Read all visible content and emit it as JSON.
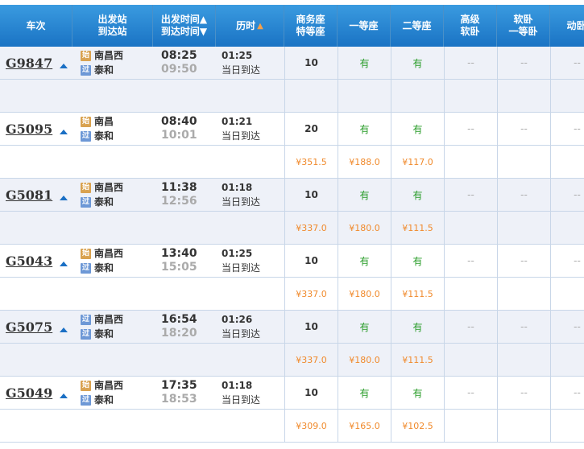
{
  "header": {
    "train": "车次",
    "station": [
      "出发站",
      "到达站"
    ],
    "time": [
      "出发时间▲",
      "到达时间▼"
    ],
    "duration": "历时",
    "seats": [
      [
        "商务座",
        "特等座"
      ],
      [
        "一等座"
      ],
      [
        "二等座"
      ],
      [
        "高级",
        "软卧"
      ],
      [
        "软卧",
        "一等卧"
      ],
      [
        "动卧"
      ]
    ]
  },
  "badges": {
    "start": "始",
    "pass": "过"
  },
  "trains": [
    {
      "no": "G9847",
      "from": "南昌西",
      "from_type": "start",
      "to": "泰和",
      "dep": "08:25",
      "arr": "09:50",
      "dur": "01:25",
      "day": "当日到达",
      "avail": [
        "10",
        "有",
        "有",
        "--",
        "--",
        "--"
      ],
      "prices": [
        "",
        "",
        "",
        "",
        "",
        ""
      ]
    },
    {
      "no": "G5095",
      "from": "南昌",
      "from_type": "start",
      "to": "泰和",
      "dep": "08:40",
      "arr": "10:01",
      "dur": "01:21",
      "day": "当日到达",
      "avail": [
        "20",
        "有",
        "有",
        "--",
        "--",
        "--"
      ],
      "prices": [
        "¥351.5",
        "¥188.0",
        "¥117.0",
        "",
        "",
        ""
      ]
    },
    {
      "no": "G5081",
      "from": "南昌西",
      "from_type": "start",
      "to": "泰和",
      "dep": "11:38",
      "arr": "12:56",
      "dur": "01:18",
      "day": "当日到达",
      "avail": [
        "10",
        "有",
        "有",
        "--",
        "--",
        "--"
      ],
      "prices": [
        "¥337.0",
        "¥180.0",
        "¥111.5",
        "",
        "",
        ""
      ]
    },
    {
      "no": "G5043",
      "from": "南昌西",
      "from_type": "start",
      "to": "泰和",
      "dep": "13:40",
      "arr": "15:05",
      "dur": "01:25",
      "day": "当日到达",
      "avail": [
        "10",
        "有",
        "有",
        "--",
        "--",
        "--"
      ],
      "prices": [
        "¥337.0",
        "¥180.0",
        "¥111.5",
        "",
        "",
        ""
      ]
    },
    {
      "no": "G5075",
      "from": "南昌西",
      "from_type": "pass",
      "to": "泰和",
      "dep": "16:54",
      "arr": "18:20",
      "dur": "01:26",
      "day": "当日到达",
      "avail": [
        "10",
        "有",
        "有",
        "--",
        "--",
        "--"
      ],
      "prices": [
        "¥337.0",
        "¥180.0",
        "¥111.5",
        "",
        "",
        ""
      ]
    },
    {
      "no": "G5049",
      "from": "南昌西",
      "from_type": "start",
      "to": "泰和",
      "dep": "17:35",
      "arr": "18:53",
      "dur": "01:18",
      "day": "当日到达",
      "avail": [
        "10",
        "有",
        "有",
        "--",
        "--",
        "--"
      ],
      "prices": [
        "¥309.0",
        "¥165.0",
        "¥102.5",
        "",
        "",
        ""
      ]
    }
  ]
}
